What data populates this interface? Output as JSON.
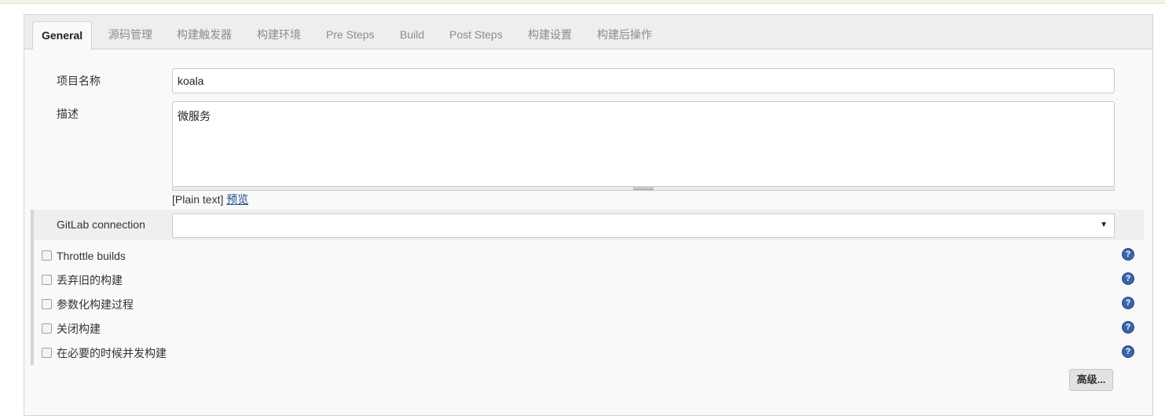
{
  "tabs": [
    {
      "label": "General",
      "active": true
    },
    {
      "label": "源码管理",
      "active": false
    },
    {
      "label": "构建触发器",
      "active": false
    },
    {
      "label": "构建环境",
      "active": false
    },
    {
      "label": "Pre Steps",
      "active": false
    },
    {
      "label": "Build",
      "active": false
    },
    {
      "label": "Post Steps",
      "active": false
    },
    {
      "label": "构建设置",
      "active": false
    },
    {
      "label": "构建后操作",
      "active": false
    }
  ],
  "project_name": {
    "label": "项目名称",
    "value": "koala"
  },
  "description": {
    "label": "描述",
    "value": "微服务",
    "format_text": "[Plain text]",
    "preview_link": "预览"
  },
  "gitlab_connection": {
    "label": "GitLab connection",
    "selected": ""
  },
  "options": [
    {
      "label": "Throttle builds",
      "checked": false
    },
    {
      "label": "丢弃旧的构建",
      "checked": false
    },
    {
      "label": "参数化构建过程",
      "checked": false
    },
    {
      "label": "关闭构建",
      "checked": false
    },
    {
      "label": "在必要的时候并发构建",
      "checked": false
    }
  ],
  "help_icon_glyph": "?",
  "advanced_button": "高级..."
}
